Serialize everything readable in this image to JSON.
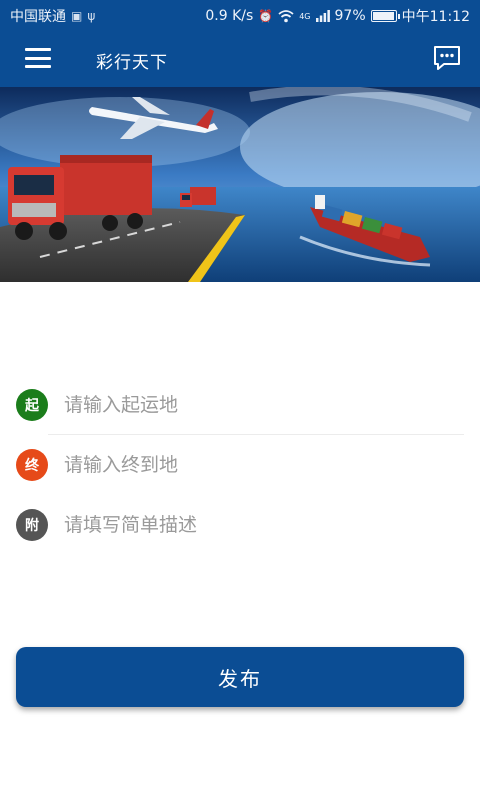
{
  "status_bar": {
    "carrier": "中国联通",
    "speed": "0.9 K/s",
    "network": "4G",
    "battery": "97%",
    "battery_level": 0.97,
    "time": "中午11:12"
  },
  "app_bar": {
    "title": "彩行天下",
    "menu_icon": "hamburger-menu-icon",
    "message_icon": "chat-bubble-icon"
  },
  "banner": {
    "icon": "logistics-banner-image"
  },
  "form": {
    "origin": {
      "badge": "起",
      "placeholder": "请输入起运地",
      "value": ""
    },
    "destination": {
      "badge": "终",
      "placeholder": "请输入终到地",
      "value": ""
    },
    "note": {
      "badge": "附",
      "placeholder": "请填写简单描述",
      "value": ""
    }
  },
  "publish_button": {
    "label": "发布"
  },
  "colors": {
    "primary": "#0b4d94",
    "origin_badge": "#1b7d1b",
    "destination_badge": "#e64a19",
    "note_badge": "#555555"
  }
}
